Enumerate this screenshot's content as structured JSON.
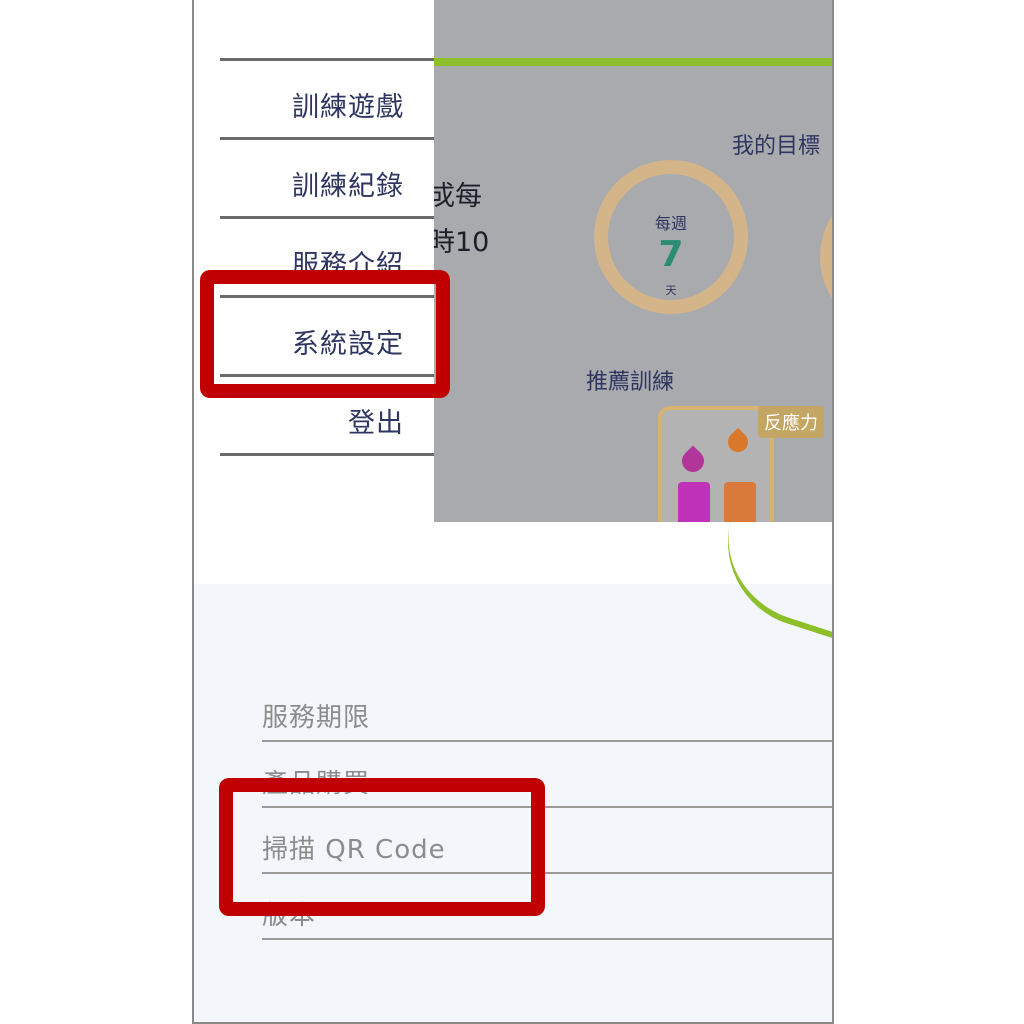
{
  "menu": {
    "items": [
      {
        "label": "訓練遊戲"
      },
      {
        "label": "訓練紀錄"
      },
      {
        "label": "服務介紹"
      },
      {
        "label": "系統設定"
      },
      {
        "label": "登出"
      }
    ]
  },
  "home": {
    "goal_title": "我的目標",
    "peek_line1": "戓每",
    "peek_line2": "時10",
    "weekly_label": "每週",
    "weekly_value": "7",
    "weekly_unit": "天",
    "recommend_title": "推薦訓練",
    "card_badge": "反應力"
  },
  "settings": {
    "items": [
      {
        "label": "服務期限"
      },
      {
        "label": "產品購買"
      },
      {
        "label": "掃描 QR Code"
      },
      {
        "label": "版本"
      }
    ]
  },
  "colors": {
    "highlight": "#c00000",
    "accent_green": "#8dbf2b",
    "ring": "#d4b589",
    "number": "#2b8c73"
  }
}
